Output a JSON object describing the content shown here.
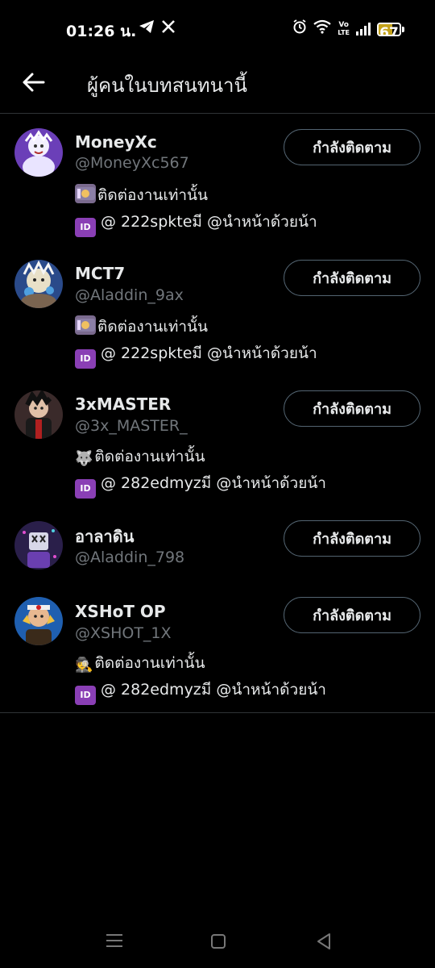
{
  "status_bar": {
    "time": "01:26 น.",
    "battery_level": "67",
    "icons": [
      "telegram-icon",
      "x-icon",
      "alarm-icon",
      "wifi-icon",
      "volte-icon",
      "signal-icon",
      "battery-icon"
    ],
    "volte_line1": "Vo",
    "volte_line2": "LTE"
  },
  "header": {
    "title": "ผู้คนในบทสนทนานี้",
    "back_icon": "arrow-left-icon"
  },
  "colors": {
    "background": "#000000",
    "text_primary": "#e7e9ea",
    "text_secondary": "#71767b",
    "button_border": "#536471"
  },
  "users": [
    {
      "name": "MoneyXc",
      "handle": "@MoneyXc567",
      "follow_label": "กำลังติดตาม",
      "bio_line1_icon": "money-with-wings-emoji",
      "bio_line1": "ติดต่องานเท่านั้น",
      "bio_line2_icon": "id-emoji",
      "bio_line2_icon_text": "ID",
      "bio_line2": "@ 222spkteมี @นำหน้าด้วยน้า"
    },
    {
      "name": "MCT7",
      "handle": "@Aladdin_9ax",
      "follow_label": "กำลังติดตาม",
      "bio_line1_icon": "money-with-wings-emoji",
      "bio_line1": "ติดต่องานเท่านั้น",
      "bio_line2_icon": "id-emoji",
      "bio_line2_icon_text": "ID",
      "bio_line2": "@ 222spkteมี @นำหน้าด้วยน้า"
    },
    {
      "name": "3xMASTER",
      "handle": "@3x_MASTER_",
      "follow_label": "กำลังติดตาม",
      "bio_line1_icon": "wolf-emoji",
      "bio_line1_glyph": "🐺",
      "bio_line1": "ติดต่องานเท่านั้น",
      "bio_line2_icon": "id-emoji",
      "bio_line2_icon_text": "ID",
      "bio_line2": "@ 282edmyzมี @นำหน้าด้วยน้า"
    },
    {
      "name": "อาลาดิน",
      "handle": "@Aladdin_798",
      "follow_label": "กำลังติดตาม"
    },
    {
      "name": "XSHoT OP",
      "handle": "@XSHOT_1X",
      "follow_label": "กำลังติดตาม",
      "bio_line1_icon": "detective-emoji",
      "bio_line1_glyph": "🕵",
      "bio_line1": "ติดต่องานเท่านั้น",
      "bio_line2_icon": "id-emoji",
      "bio_line2_icon_text": "ID",
      "bio_line2": "@ 282edmyzมี @นำหน้าด้วยน้า"
    }
  ],
  "nav_bar": {
    "icons": [
      "recents-icon",
      "home-icon",
      "back-triangle-icon"
    ]
  }
}
